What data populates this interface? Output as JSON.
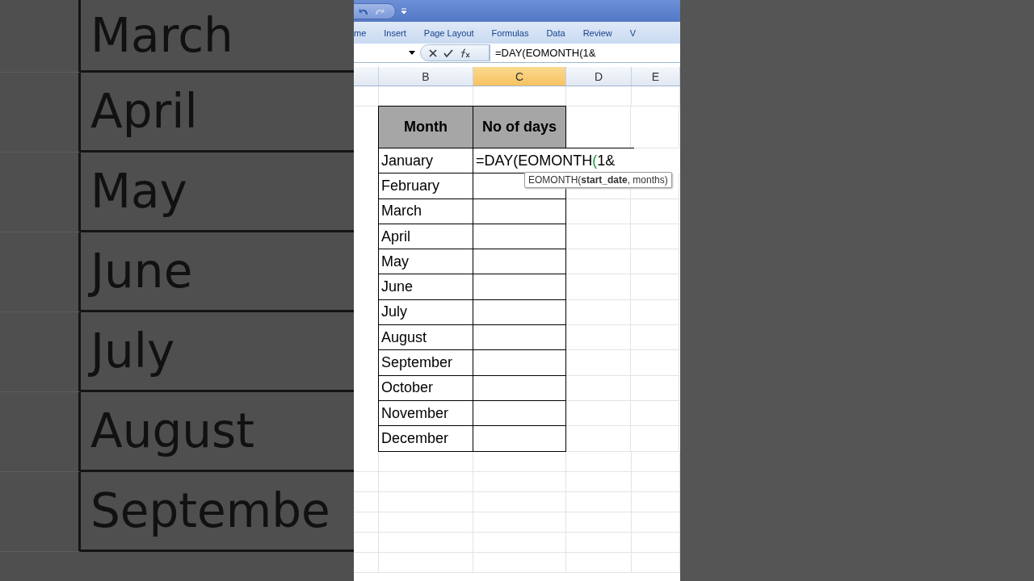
{
  "backdrop": {
    "months": [
      "March",
      "April",
      "May",
      "June",
      "July",
      "August",
      "Septembe"
    ]
  },
  "ribbon": {
    "tabs": [
      {
        "label": "me",
        "selected": false
      },
      {
        "label": "Insert",
        "selected": false
      },
      {
        "label": "Page Layout",
        "selected": false
      },
      {
        "label": "Formulas",
        "selected": false
      },
      {
        "label": "Data",
        "selected": false
      },
      {
        "label": "Review",
        "selected": false
      },
      {
        "label": "V",
        "selected": false
      }
    ]
  },
  "formula_bar": {
    "formula": "=DAY(EOMONTH(1&"
  },
  "columns": [
    {
      "selected": false
    },
    {
      "label": "B",
      "selected": false
    },
    {
      "label": "C",
      "selected": true
    },
    {
      "label": "D",
      "selected": false
    },
    {
      "label": "E",
      "selected": false
    }
  ],
  "table": {
    "headers": [
      "Month",
      "No of days"
    ],
    "rows": [
      {
        "month": "January",
        "editing": [
          {
            "text": "=DAY(EOMONTH",
            "color": "#000000"
          },
          {
            "text": "(",
            "color": "#1f9a3a"
          },
          {
            "text": "1&",
            "color": "#000000"
          }
        ]
      },
      {
        "month": "February"
      },
      {
        "month": "March"
      },
      {
        "month": "April"
      },
      {
        "month": "May"
      },
      {
        "month": "June"
      },
      {
        "month": "July"
      },
      {
        "month": "August"
      },
      {
        "month": "September"
      },
      {
        "month": "October"
      },
      {
        "month": "November"
      },
      {
        "month": "December"
      }
    ]
  },
  "tooltip": "EOMONTH(**start_date**, months)"
}
